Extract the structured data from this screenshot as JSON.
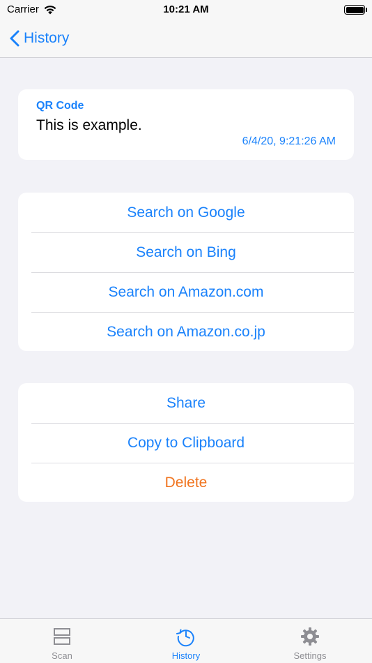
{
  "status_bar": {
    "carrier": "Carrier",
    "time": "10:21 AM"
  },
  "nav": {
    "back_label": "History"
  },
  "result": {
    "type": "QR Code",
    "text": "This is example.",
    "timestamp": "6/4/20, 9:21:26 AM"
  },
  "search_actions": [
    {
      "label": "Search on Google"
    },
    {
      "label": "Search on Bing"
    },
    {
      "label": "Search on Amazon.com"
    },
    {
      "label": "Search on Amazon.co.jp"
    }
  ],
  "actions": {
    "share": "Share",
    "copy": "Copy to Clipboard",
    "delete": "Delete"
  },
  "tabs": [
    {
      "label": "Scan",
      "icon": "scan-icon",
      "active": false
    },
    {
      "label": "History",
      "icon": "history-icon",
      "active": true
    },
    {
      "label": "Settings",
      "icon": "gear-icon",
      "active": false
    }
  ],
  "colors": {
    "accent": "#1a82fb",
    "destructive": "#f0741f",
    "inactive": "#8e8e93"
  }
}
